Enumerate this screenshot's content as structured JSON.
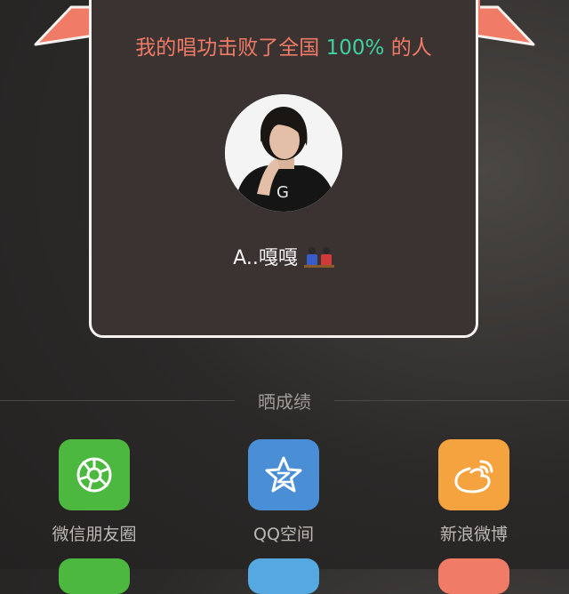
{
  "result": {
    "headline_prefix": "我的唱功击败了全国",
    "headline_percent": "100%",
    "headline_suffix": "的人",
    "user_name": "A..嘎嘎"
  },
  "share": {
    "title": "晒成绩",
    "targets": [
      {
        "label": "微信朋友圈",
        "icon": "wechat-moments-icon",
        "color": "#4cb83f"
      },
      {
        "label": "QQ空间",
        "icon": "qzone-star-icon",
        "color": "#4a8fd6"
      },
      {
        "label": "新浪微博",
        "icon": "sina-weibo-icon",
        "color": "#f5a33e"
      }
    ],
    "more_tiles": [
      "#4cb83f",
      "#56a8e0",
      "#f07b66"
    ]
  },
  "colors": {
    "ribbon": "#f07b66",
    "highlight": "#3fd2a0",
    "card_border": "#f4f1ee"
  }
}
